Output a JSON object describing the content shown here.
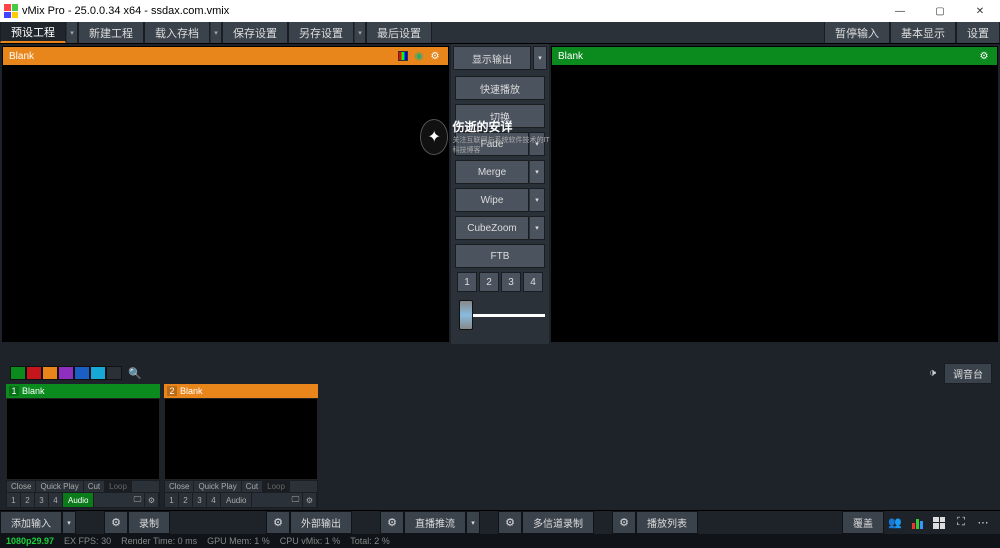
{
  "window": {
    "title": "vMix Pro - 25.0.0.34 x64 - ssdax.com.vmix"
  },
  "toolbar": {
    "preset_project": "预设工程",
    "new_project": "新建工程",
    "load_save": "载入存档",
    "save_settings": "保存设置",
    "save_as": "另存设置",
    "last_settings": "最后设置",
    "display_output": "显示输出",
    "pause_input": "暂停输入",
    "basic_display": "基本显示",
    "settings": "设置"
  },
  "preview": {
    "label": "Blank"
  },
  "output": {
    "label": "Blank"
  },
  "center": {
    "quickplay": "快速播放",
    "cut": "切换",
    "fade": "Fade",
    "merge": "Merge",
    "wipe": "Wipe",
    "cubezoom": "CubeZoom",
    "ftb": "FTB",
    "n1": "1",
    "n2": "2",
    "n3": "3",
    "n4": "4"
  },
  "watermark": {
    "title": "伤逝的安详",
    "sub": "关注互联网与系统软件技术的IT科技博客"
  },
  "mixer": {
    "audio_mixer": "调音台"
  },
  "palette": [
    "#0b8a1e",
    "#c4161c",
    "#e8861b",
    "#8e2fbf",
    "#1b5fc4",
    "#18a8d8",
    "#2b2f36"
  ],
  "inputs": [
    {
      "n": "1",
      "label": "Blank",
      "color": "green",
      "audio_on": true
    },
    {
      "n": "2",
      "label": "Blank",
      "color": "orange",
      "audio_on": false
    }
  ],
  "tilefoot": {
    "close": "Close",
    "quickplay": "Quick Play",
    "cut": "Cut",
    "loop": "Loop",
    "n1": "1",
    "n2": "2",
    "n3": "3",
    "n4": "4",
    "audio": "Audio"
  },
  "bottom": {
    "add_input": "添加输入",
    "record": "录制",
    "external": "外部输出",
    "stream": "直播推流",
    "multicorder": "多信道录制",
    "playlist": "播放列表",
    "overlay": "覆盖"
  },
  "status": {
    "res": "1080p29.97",
    "fps_label": "EX  FPS:",
    "fps": "30",
    "render_label": "Render Time:",
    "render": "0 ms",
    "gpu_label": "GPU Mem:",
    "gpu": "1 %",
    "cpu_label": "CPU vMix:",
    "cpu": "1 %",
    "total_label": "Total:",
    "total": "2 %"
  }
}
